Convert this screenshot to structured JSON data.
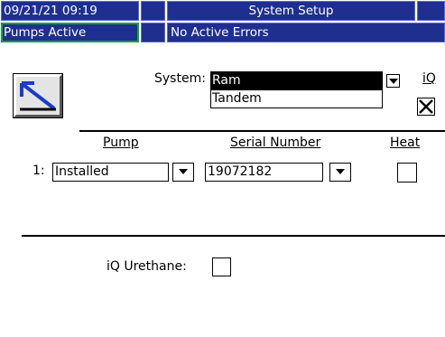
{
  "status_bar": {
    "datetime": "09/21/21 09:19",
    "screen_title": "System Setup",
    "pumps_status": "Pumps Active",
    "errors_status": "No Active Errors",
    "colors": {
      "bar_bg": "#1f2f8f",
      "active_border": "#0fa82c",
      "text": "#ffffff"
    }
  },
  "toolbar": {
    "setup_button_icon": "setup-arrow-icon"
  },
  "system": {
    "label": "System:",
    "selected": "Ram",
    "options": [
      "Ram",
      "Tandem"
    ],
    "iq_label": "iQ",
    "iq_checked": true
  },
  "pump_table": {
    "headers": {
      "pump": "Pump",
      "serial": "Serial Number",
      "heat": "Heat"
    },
    "rows": [
      {
        "index": "1:",
        "pump": "Installed",
        "serial": "19072182",
        "heat": false
      }
    ]
  },
  "iq_urethane": {
    "label": "iQ Urethane:",
    "checked": false
  }
}
